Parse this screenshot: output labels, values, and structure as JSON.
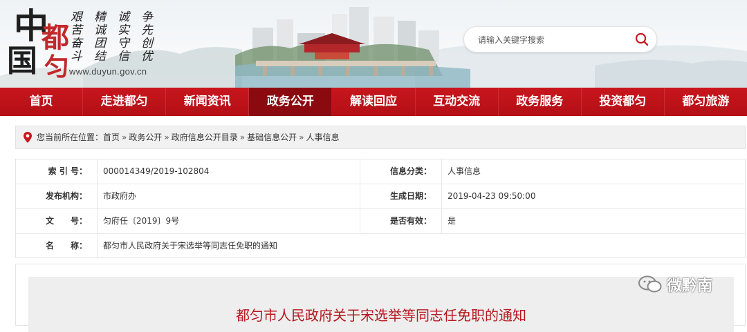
{
  "header": {
    "logo": {
      "zhong": "中",
      "guo": "国",
      "du": "都",
      "yun": "匀"
    },
    "slogans": [
      "艰苦奋斗",
      "精诚团结",
      "诚实守信",
      "争先创优"
    ],
    "url": "www.duyun.gov.cn",
    "search": {
      "placeholder": "请输入关键字搜索",
      "value": ""
    }
  },
  "nav": {
    "items": [
      "首页",
      "走进都匀",
      "新闻资讯",
      "政务公开",
      "解读回应",
      "互动交流",
      "政务服务",
      "投资都匀",
      "都匀旅游"
    ],
    "active": "政务公开"
  },
  "breadcrumb": {
    "prefix": "您当前所在位置：",
    "items": [
      "首页",
      "政务公开",
      "政府信息公开目录",
      "基础信息公开",
      "人事信息"
    ],
    "separator": "»"
  },
  "info": {
    "index_label": "索 引 号：",
    "index_value": "000014349/2019-102804",
    "category_label": "信息分类：",
    "category_value": "人事信息",
    "publisher_label": "发布机构：",
    "publisher_value": "市政府办",
    "date_label": "生成日期：",
    "date_value": "2019-04-23 09:50:00",
    "docno_label": "文　　号：",
    "docno_value": "匀府任〔2019〕9号",
    "valid_label": "是否有效：",
    "valid_value": "是",
    "name_label": "名　　称：",
    "name_value": "都匀市人民政府关于宋选举等同志任免职的通知"
  },
  "article": {
    "title": "都匀市人民政府关于宋选举等同志任免职的通知"
  },
  "watermark": {
    "text": "微黔南"
  },
  "colors": {
    "brand_red": "#c8161d",
    "nav_active": "#8a0a0f",
    "title_red": "#b5181e"
  }
}
